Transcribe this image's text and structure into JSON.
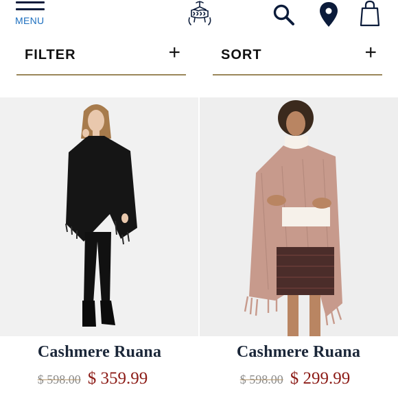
{
  "header": {
    "menu_label": "MENU",
    "icons": [
      "menu-icon",
      "golden-fleece-logo",
      "search-icon",
      "location-pin-icon",
      "shopping-bag-icon"
    ]
  },
  "controls": {
    "filter_label": "FILTER",
    "sort_label": "SORT",
    "expand_symbol": "+",
    "accent_color": "#9a8659"
  },
  "products": [
    {
      "name": "Cashmere Ruana",
      "original_price": "$ 598.00",
      "sale_price": "$ 359.99",
      "color": "black"
    },
    {
      "name": "Cashmere Ruana",
      "original_price": "$ 598.00",
      "sale_price": "$ 299.99",
      "color": "pink"
    }
  ],
  "colors": {
    "navy": "#0b1b3a",
    "menu_blue": "#1d6fbf",
    "sale_red": "#8c1b16",
    "name_navy": "#1a2638"
  }
}
